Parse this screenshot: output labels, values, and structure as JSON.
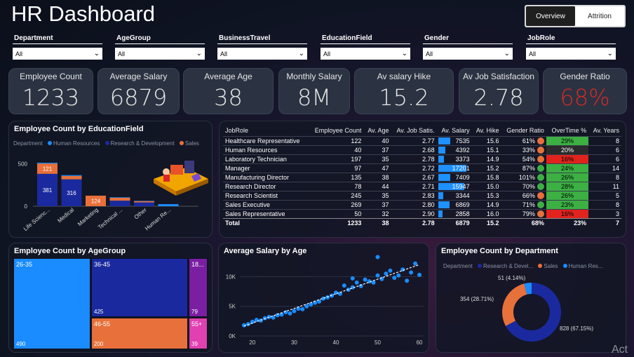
{
  "header": {
    "title": "HR Dashboard",
    "toggle": {
      "overview": "Overview",
      "attrition": "Attrition"
    }
  },
  "filters": [
    {
      "label": "Department",
      "value": "All"
    },
    {
      "label": "AgeGroup",
      "value": "All"
    },
    {
      "label": "BusinessTravel",
      "value": "All"
    },
    {
      "label": "EducationField",
      "value": "All"
    },
    {
      "label": "Gender",
      "value": "All"
    },
    {
      "label": "JobRole",
      "value": "All"
    }
  ],
  "kpis": [
    {
      "label": "Employee Count",
      "value": "1233"
    },
    {
      "label": "Average Salary",
      "value": "6879"
    },
    {
      "label": "Average Age",
      "value": "38"
    },
    {
      "label": "Monthly Salary",
      "value": "8M"
    },
    {
      "label": "Av salary Hike",
      "value": "15.2"
    },
    {
      "label": "Av Job Satisfaction",
      "value": "2.78"
    },
    {
      "label": "Gender Ratio",
      "value": "68%"
    }
  ],
  "colors": {
    "hr": "#1a8cff",
    "rd": "#1a2a9e",
    "sales": "#e8703a",
    "gender_ratio": "#d62828",
    "ot_green": "#3cb043",
    "ot_red": "#e0231d",
    "ot_dark": "#2b2b2b"
  },
  "edu_chart": {
    "title": "Employee Count by EducationField",
    "legend": {
      "title": "Department",
      "items": [
        "Human Resources",
        "Research & Development",
        "Sales"
      ]
    },
    "chart_data": {
      "type": "bar",
      "categories": [
        "Life Scienc...",
        "Medical",
        "Marketing",
        "Technical ...",
        "Other",
        "Human Re..."
      ],
      "series": [
        {
          "name": "Human Resources",
          "values": [
            10,
            10,
            0,
            6,
            4,
            25
          ]
        },
        {
          "name": "Research & Development",
          "values": [
            381,
            316,
            0,
            65,
            45,
            0
          ]
        },
        {
          "name": "Sales",
          "values": [
            121,
            40,
            124,
            35,
            15,
            0
          ]
        }
      ],
      "data_labels": {
        "Life Scienc...|Research & Development": "381",
        "Life Scienc...|Sales": "121",
        "Medical|Research & Development": "316",
        "Marketing|Sales": "124"
      },
      "y_ticks": [
        "500",
        "0"
      ],
      "ylim": [
        0,
        520
      ]
    }
  },
  "jobrole_table": {
    "columns": [
      "JobRole",
      "Employee Count",
      "Av. Age",
      "Av. Job Satis.",
      "Av. Salary",
      "Av. Hike",
      "Gender Ratio",
      "OverTime %",
      "Av. Years"
    ],
    "rows": [
      [
        "Healthcare Representative",
        "122",
        "40",
        "2.77",
        "7535",
        "15.6",
        "61%",
        "29%",
        "8"
      ],
      [
        "Human Resources",
        "40",
        "37",
        "2.68",
        "4392",
        "15.1",
        "33%",
        "20%",
        "6"
      ],
      [
        "Laboratory Technician",
        "197",
        "35",
        "2.78",
        "3373",
        "14.9",
        "54%",
        "16%",
        "6"
      ],
      [
        "Manager",
        "97",
        "47",
        "2.72",
        "17201",
        "15.2",
        "87%",
        "24%",
        "14"
      ],
      [
        "Manufacturing Director",
        "135",
        "38",
        "2.67",
        "7409",
        "15.8",
        "101%",
        "26%",
        "8"
      ],
      [
        "Research Director",
        "78",
        "44",
        "2.71",
        "15947",
        "15.0",
        "70%",
        "28%",
        "11"
      ],
      [
        "Research Scientist",
        "245",
        "35",
        "2.83",
        "3344",
        "15.3",
        "66%",
        "26%",
        "5"
      ],
      [
        "Sales Executive",
        "269",
        "37",
        "2.80",
        "6869",
        "14.9",
        "71%",
        "23%",
        "8"
      ],
      [
        "Sales Representative",
        "50",
        "32",
        "2.90",
        "2858",
        "16.0",
        "79%",
        "16%",
        "3"
      ]
    ],
    "gender_dot_colors": [
      "#e8703a",
      "#e8703a",
      "#e8703a",
      "#3cb043",
      "#3cb043",
      "#3cb043",
      "#e8703a",
      "#3cb043",
      "#e8703a"
    ],
    "overtime_colors": [
      "#3cb043",
      "#2b2b2b",
      "#e0231d",
      "#3cb043",
      "#3cb043",
      "#3cb043",
      "#3cb043",
      "#3cb043",
      "#e0231d"
    ],
    "total": [
      "Total",
      "1233",
      "38",
      "2.78",
      "6879",
      "15.2",
      "68%",
      "23%",
      "7"
    ]
  },
  "age_treemap": {
    "title": "Employee Count by AgeGroup",
    "chart_data": {
      "type": "treemap",
      "items": [
        {
          "label": "26-35",
          "value": "490",
          "color": "#1a8cff"
        },
        {
          "label": "36-45",
          "value": "425",
          "color": "#1a2a9e"
        },
        {
          "label": "46-55",
          "value": "200",
          "color": "#e8703a"
        },
        {
          "label": "18...",
          "value": "79",
          "color": "#7a1fa2"
        },
        {
          "label": "55+",
          "value": "39",
          "color": "#e040b0"
        }
      ]
    }
  },
  "salary_age": {
    "title": "Average Salary by Age",
    "chart_data": {
      "type": "scatter",
      "x_ticks": [
        "20",
        "30",
        "40",
        "50",
        "60"
      ],
      "y_ticks": [
        "0K",
        "5K",
        "10K"
      ],
      "xlim": [
        17,
        61
      ],
      "ylim": [
        0,
        13000
      ],
      "points": [
        [
          18,
          1800
        ],
        [
          19,
          2000
        ],
        [
          20,
          2400
        ],
        [
          21,
          2700
        ],
        [
          22,
          2600
        ],
        [
          23,
          3000
        ],
        [
          24,
          3200
        ],
        [
          25,
          3100
        ],
        [
          26,
          3500
        ],
        [
          27,
          3600
        ],
        [
          28,
          4000
        ],
        [
          29,
          3800
        ],
        [
          30,
          4200
        ],
        [
          31,
          4600
        ],
        [
          32,
          4500
        ],
        [
          33,
          5000
        ],
        [
          34,
          5300
        ],
        [
          35,
          5600
        ],
        [
          36,
          5800
        ],
        [
          37,
          6300
        ],
        [
          38,
          6500
        ],
        [
          39,
          6800
        ],
        [
          40,
          7300
        ],
        [
          41,
          7100
        ],
        [
          42,
          8500
        ],
        [
          43,
          7800
        ],
        [
          44,
          8200
        ],
        [
          45,
          9000
        ],
        [
          46,
          8400
        ],
        [
          47,
          9500
        ],
        [
          48,
          9200
        ],
        [
          49,
          9000
        ],
        [
          50,
          10200
        ],
        [
          51,
          9600
        ],
        [
          52,
          10500
        ],
        [
          53,
          11000
        ],
        [
          54,
          9800
        ],
        [
          55,
          10200
        ],
        [
          56,
          11200
        ],
        [
          57,
          9300
        ],
        [
          58,
          10700
        ],
        [
          59,
          12200
        ],
        [
          60,
          10300
        ],
        [
          50,
          13300
        ],
        [
          44,
          9700
        ]
      ],
      "trendline": true
    }
  },
  "dept_donut": {
    "title": "Employee Count by Department",
    "legend": {
      "title": "Department",
      "items": [
        "Research & Devel...",
        "Sales",
        "Human Res..."
      ]
    },
    "chart_data": {
      "type": "pie",
      "slices": [
        {
          "name": "Research & Development",
          "value": 828,
          "label": "828 (67.15%)",
          "color": "#1a2a9e"
        },
        {
          "name": "Sales",
          "value": 354,
          "label": "354 (28.71%)",
          "color": "#e8703a"
        },
        {
          "name": "Human Resources",
          "value": 51,
          "label": "51 (4.14%)",
          "color": "#1a8cff"
        }
      ]
    }
  },
  "watermark": "Act"
}
